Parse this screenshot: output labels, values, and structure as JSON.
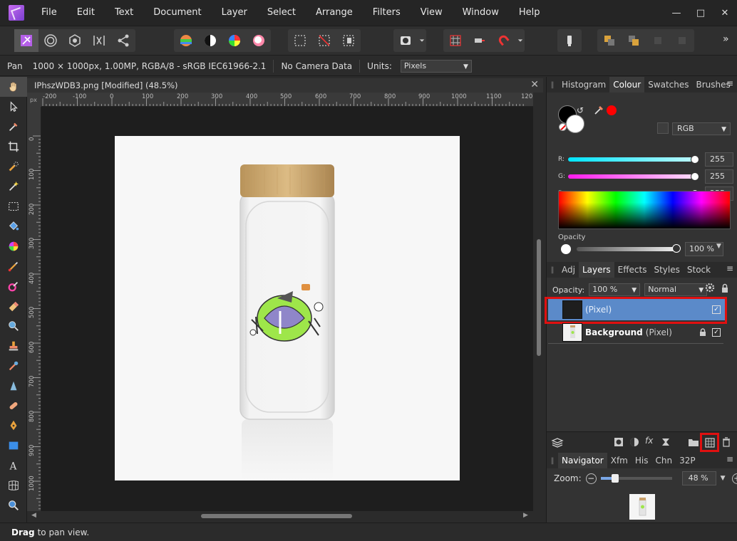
{
  "menubar": {
    "items": [
      "File",
      "Edit",
      "Text",
      "Document",
      "Layer",
      "Select",
      "Arrange",
      "Filters",
      "View",
      "Window",
      "Help"
    ],
    "window_controls": [
      "minimize",
      "maximize",
      "close"
    ]
  },
  "toolbar": {
    "overflow_label": "»"
  },
  "context": {
    "tool": "Pan",
    "doc_info": "1000 × 1000px, 1.00MP, RGBA/8 - sRGB IEC61966-2.1",
    "camera": "No Camera Data",
    "units_label": "Units:",
    "units_value": "Pixels"
  },
  "document": {
    "tab_title": "IPhszWDB3.png [Modified] (48.5%)",
    "ruler_unit": "px",
    "ruler_top": [
      "-200",
      "-100",
      "0",
      "100",
      "200",
      "300",
      "400",
      "500",
      "600",
      "700",
      "800",
      "900",
      "1000",
      "1100",
      "120"
    ],
    "ruler_left": [
      "0",
      "100",
      "200",
      "300",
      "400",
      "500",
      "600",
      "700",
      "800",
      "900",
      "1000"
    ]
  },
  "colour_panel": {
    "tabs": [
      "Histogram",
      "Colour",
      "Swatches",
      "Brushes"
    ],
    "active_tab": "Colour",
    "model": "RGB",
    "channels": [
      {
        "label": "R:",
        "value": "255",
        "color": "#00e5ff"
      },
      {
        "label": "G:",
        "value": "255",
        "color": "#ff4cf5"
      },
      {
        "label": "B:",
        "value": "255",
        "color": "#ffff00"
      }
    ],
    "opacity_label": "Opacity",
    "opacity_value": "100 %"
  },
  "layers_panel": {
    "tabs": [
      "Adj",
      "Layers",
      "Effects",
      "Styles",
      "Stock"
    ],
    "active_tab": "Layers",
    "opacity_label": "Opacity:",
    "opacity_value": "100 %",
    "blend_mode": "Normal",
    "layers": [
      {
        "name": "",
        "type": "(Pixel)",
        "selected": true,
        "visible": true,
        "locked": false
      },
      {
        "name": "Background",
        "type": "(Pixel)",
        "selected": false,
        "visible": true,
        "locked": true
      }
    ]
  },
  "navigator_panel": {
    "tabs": [
      "Navigator",
      "Xfm",
      "His",
      "Chn",
      "32P"
    ],
    "active_tab": "Navigator",
    "zoom_label": "Zoom:",
    "zoom_value": "48 %",
    "zoom_level": 0.2
  },
  "status": {
    "action": "Drag",
    "hint": "to pan view."
  }
}
